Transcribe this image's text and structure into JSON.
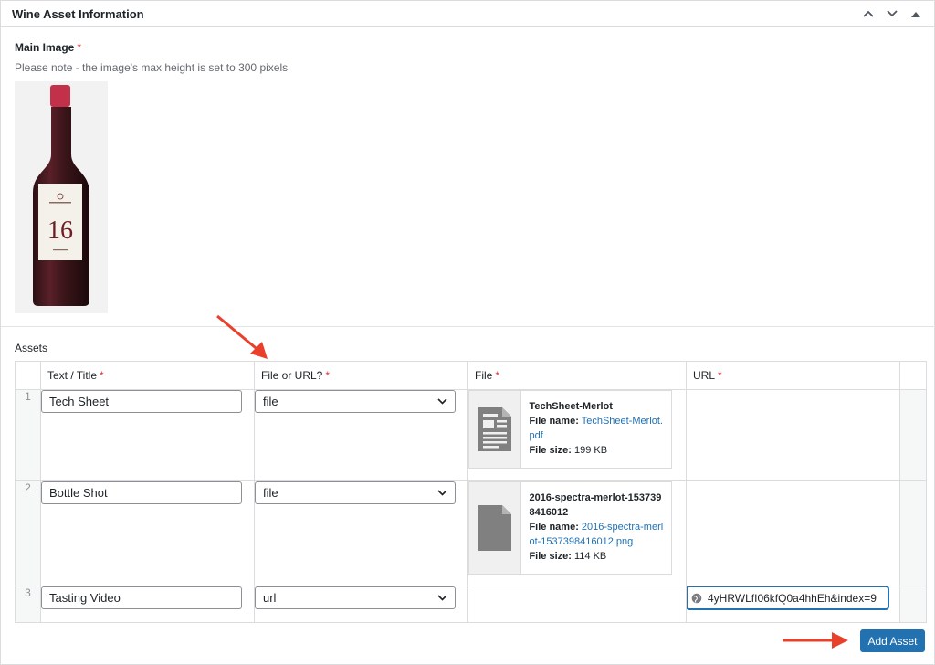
{
  "panel": {
    "title": "Wine Asset Information",
    "controls": [
      "chevron-up-icon",
      "chevron-down-icon",
      "triangle-up-icon"
    ]
  },
  "main_image": {
    "label": "Main Image",
    "required_mark": "*",
    "note": "Please note - the image's max height is set to 300 pixels",
    "bottle_label_text": "16"
  },
  "assets": {
    "label": "Assets",
    "headers": {
      "title": "Text / Title",
      "type": "File or URL?",
      "file": "File",
      "url": "URL"
    },
    "rows": [
      {
        "num": "1",
        "title": "Tech Sheet",
        "type": "file",
        "file": {
          "icon": "document-icon",
          "title": "TechSheet-Merlot",
          "name_label": "File name:",
          "name": "TechSheet-Merlot.pdf",
          "size_label": "File size:",
          "size": "199 KB"
        },
        "url": ""
      },
      {
        "num": "2",
        "title": "Bottle Shot",
        "type": "file",
        "file": {
          "icon": "file-icon",
          "title": "2016-spectra-merlot-1537398416012",
          "name_label": "File name:",
          "name": "2016-spectra-merlot-1537398416012.png",
          "size_label": "File size:",
          "size": "114 KB"
        },
        "url": ""
      },
      {
        "num": "3",
        "title": "Tasting Video",
        "type": "url",
        "file": null,
        "url": "4yHRWLfI06kfQ0a4hhEh&index=9"
      }
    ],
    "add_button": "Add Asset"
  },
  "colors": {
    "accent": "#2271b1",
    "required": "#d63638",
    "arrow": "#e8402a"
  }
}
